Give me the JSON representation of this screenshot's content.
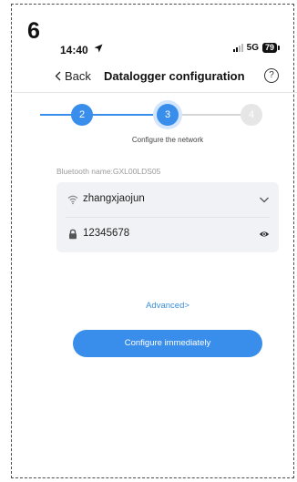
{
  "annotation": {
    "step_number": "6"
  },
  "status_bar": {
    "time": "14:40",
    "network": "5G",
    "battery": "79"
  },
  "nav": {
    "back_label": "Back",
    "title": "Datalogger configuration"
  },
  "stepper": {
    "steps": [
      {
        "number": "2",
        "state": "done"
      },
      {
        "number": "3",
        "state": "current"
      },
      {
        "number": "4",
        "state": "pending"
      }
    ],
    "current_caption": "Configure the network"
  },
  "bluetooth": {
    "label": "Bluetooth name:GXL00LDS05"
  },
  "form": {
    "ssid_value": "zhangxjaojun",
    "password_value": "12345678"
  },
  "advanced_link": "Advanced>",
  "primary_button": "Configure immediately",
  "colors": {
    "accent": "#3a8eeb",
    "step_pending": "#e6e6e6",
    "field_bg": "#f1f2f5",
    "link": "#3d8ddc"
  }
}
